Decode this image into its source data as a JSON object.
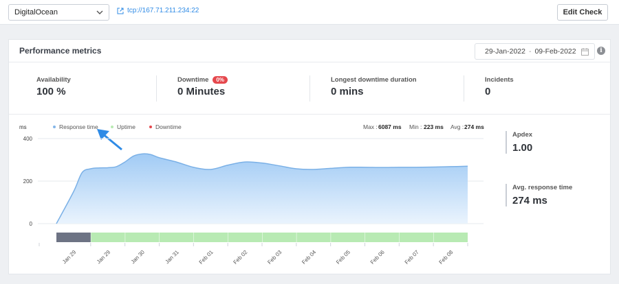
{
  "header": {
    "provider_select": "DigitalOcean",
    "tcp_link": "tcp://167.71.211.234:22",
    "edit_button": "Edit Check"
  },
  "panel": {
    "title": "Performance metrics",
    "date_start": "29-Jan-2022",
    "date_separator": "-",
    "date_end": "09-Feb-2022",
    "info": "i"
  },
  "stats": {
    "availability": {
      "label": "Availability",
      "value": "100 %"
    },
    "downtime": {
      "label": "Downtime",
      "badge": "0%",
      "value": "0 Minutes"
    },
    "longest": {
      "label": "Longest downtime duration",
      "value": "0 mins"
    },
    "incidents": {
      "label": "Incidents",
      "value": "0"
    }
  },
  "side": {
    "apdex": {
      "label": "Apdex",
      "value": "1.00"
    },
    "avg": {
      "label": "Avg. response time",
      "value": "274 ms"
    }
  },
  "chart_data": {
    "type": "area",
    "ylabel": "ms",
    "ylim": [
      0,
      400
    ],
    "yticks": [
      "400",
      "200",
      "0"
    ],
    "legend": [
      {
        "name": "Response time",
        "color": "#84b6e8"
      },
      {
        "name": "Uptime",
        "color": "#b8eab3"
      },
      {
        "name": "Downtime",
        "color": "#e5484d"
      }
    ],
    "max": {
      "label": "Max :",
      "value": "6087 ms"
    },
    "min": {
      "label": "Min :",
      "value": "223 ms"
    },
    "avg": {
      "label": "Avg :",
      "value": "274 ms"
    },
    "x_labels": [
      "Jan 29",
      "Jan 29",
      "Jan 30",
      "Jan 31",
      "Feb 01",
      "Feb 02",
      "Feb 03",
      "Feb 04",
      "Feb 05",
      "Feb 06",
      "Feb 07",
      "Feb 08"
    ],
    "series": [
      {
        "name": "Response time",
        "x": [
          0,
          0.5,
          0.75,
          1,
          1.25,
          1.5,
          1.75,
          2,
          2.25,
          2.5,
          2.75,
          3,
          3.5,
          4,
          4.5,
          5,
          5.5,
          6,
          6.5,
          7,
          7.5,
          8,
          8.5,
          9,
          9.5,
          10,
          10.5,
          11,
          11.5,
          12
        ],
        "values": [
          0,
          150,
          240,
          258,
          262,
          263,
          268,
          290,
          318,
          328,
          325,
          310,
          290,
          265,
          255,
          275,
          290,
          285,
          272,
          258,
          255,
          260,
          265,
          265,
          264,
          265,
          265,
          266,
          268,
          270
        ]
      }
    ],
    "uptime_blocks": [
      "no-data",
      "up",
      "up",
      "up",
      "up",
      "up",
      "up",
      "up",
      "up",
      "up",
      "up",
      "up"
    ]
  }
}
